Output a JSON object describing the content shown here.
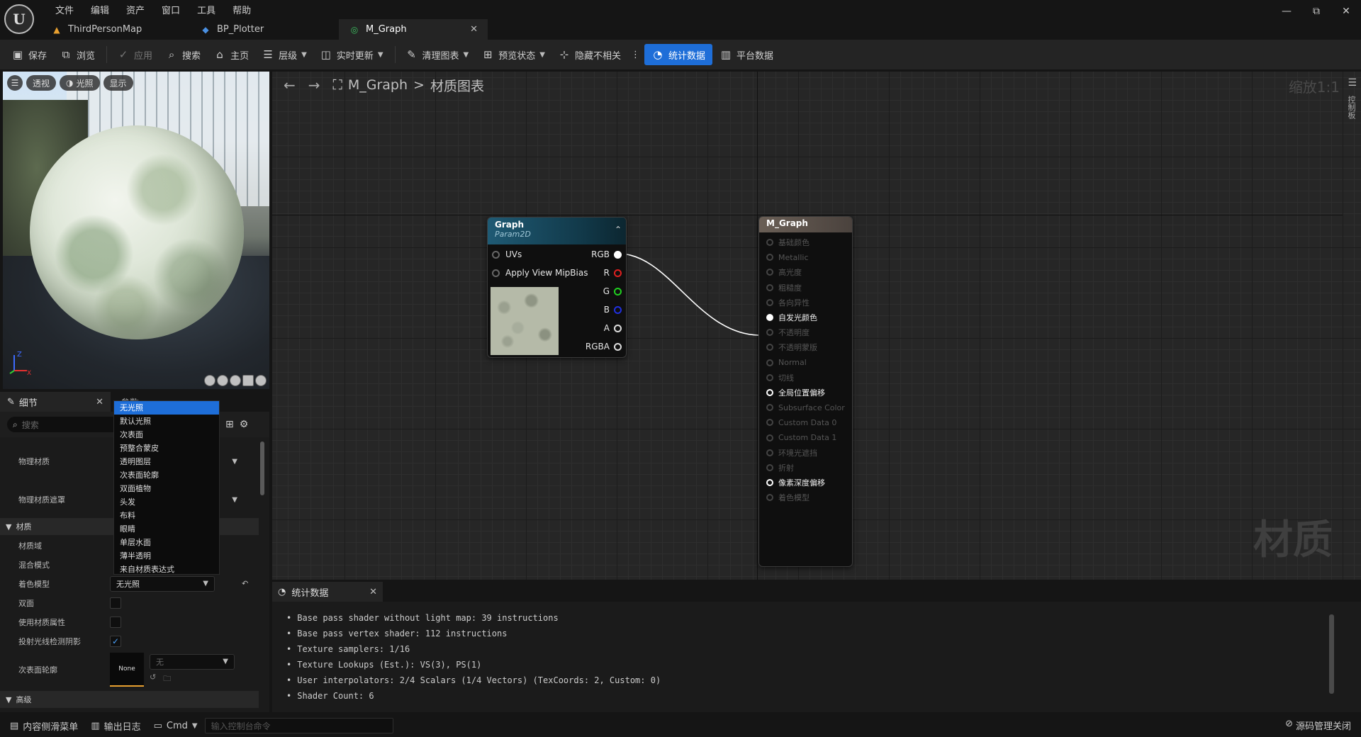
{
  "app": {
    "menu": [
      "文件",
      "编辑",
      "资产",
      "窗口",
      "工具",
      "帮助"
    ],
    "window_controls": [
      "—",
      "⧉",
      "✕"
    ]
  },
  "doc_tabs": [
    {
      "label": "ThirdPersonMap",
      "icon": "map-icon"
    },
    {
      "label": "BP_Plotter",
      "icon": "blueprint-icon"
    },
    {
      "label": "M_Graph",
      "icon": "material-icon",
      "active": true
    }
  ],
  "toolbar": {
    "save": "保存",
    "browse": "浏览",
    "apply": "应用",
    "search": "搜索",
    "home": "主页",
    "hierarchy": "层级",
    "live_update": "实时更新",
    "clean_graph": "清理图表",
    "preview_state": "预览状态",
    "hide_unrelated": "隐藏不相关",
    "stats": "统计数据",
    "platform_stats": "平台数据"
  },
  "viewport": {
    "perspective": "透视",
    "lit": "光照",
    "show": "显示",
    "axis_z": "Z",
    "axis_x": "X"
  },
  "details": {
    "tab_label": "细节",
    "params_tab": "参数",
    "search_placeholder": "搜索",
    "rows": {
      "phys_material": "物理材质",
      "phys_material_mask": "物理材质遮罩",
      "material_cat": "材质",
      "material_domain": "材质域",
      "blend_mode": "混合模式",
      "shading_model": "着色模型",
      "shading_model_value": "无光照",
      "two_sided": "双面",
      "use_material_attributes": "使用材质属性",
      "cast_ray_traced_shadows": "投射光线检测阴影",
      "subsurface_profile": "次表面轮廓",
      "subsurface_none": "None",
      "subsurface_value": "无",
      "advanced_cat": "高级"
    }
  },
  "dropdown_options": [
    "无光照",
    "默认光照",
    "次表面",
    "预整合蒙皮",
    "透明图层",
    "次表面轮廓",
    "双面植物",
    "头发",
    "布料",
    "眼睛",
    "单层水面",
    "薄半透明",
    "来自材质表达式"
  ],
  "graph": {
    "breadcrumb_root": "M_Graph",
    "breadcrumb_sep": ">",
    "breadcrumb_page": "材质图表",
    "zoom": "缩放1:1",
    "watermark": "材质",
    "rail_label": "控制板"
  },
  "node_texture": {
    "title": "Graph",
    "subtitle": "Param2D",
    "inputs": [
      "UVs",
      "Apply View MipBias"
    ],
    "outputs": [
      {
        "label": "RGB",
        "color": "#ffffff"
      },
      {
        "label": "R",
        "color": "#e02020"
      },
      {
        "label": "G",
        "color": "#20d020"
      },
      {
        "label": "B",
        "color": "#2030e0"
      },
      {
        "label": "A",
        "color": "#dddddd"
      },
      {
        "label": "RGBA",
        "color": "#dddddd"
      }
    ]
  },
  "node_material": {
    "title": "M_Graph",
    "pins": [
      {
        "label": "基础颜色",
        "active": false
      },
      {
        "label": "Metallic",
        "active": false
      },
      {
        "label": "高光度",
        "active": false
      },
      {
        "label": "粗糙度",
        "active": false
      },
      {
        "label": "各向异性",
        "active": false
      },
      {
        "label": "自发光颜色",
        "active": true,
        "connected": true
      },
      {
        "label": "不透明度",
        "active": false
      },
      {
        "label": "不透明蒙版",
        "active": false
      },
      {
        "label": "Normal",
        "active": false
      },
      {
        "label": "切线",
        "active": false
      },
      {
        "label": "全局位置偏移",
        "active": true
      },
      {
        "label": "Subsurface Color",
        "active": false
      },
      {
        "label": "Custom Data 0",
        "active": false
      },
      {
        "label": "Custom Data 1",
        "active": false
      },
      {
        "label": "环境光遮挡",
        "active": false
      },
      {
        "label": "折射",
        "active": false
      },
      {
        "label": "像素深度偏移",
        "active": true
      },
      {
        "label": "着色模型",
        "active": false
      }
    ]
  },
  "stats": {
    "tab_label": "统计数据",
    "lines": [
      "Base pass shader without light map: 39 instructions",
      "Base pass vertex shader: 112 instructions",
      "Texture samplers: 1/16",
      "Texture Lookups (Est.): VS(3), PS(1)",
      "User interpolators: 2/4 Scalars (1/4 Vectors) (TexCoords: 2, Custom: 0)",
      "Shader Count: 6"
    ]
  },
  "statusbar": {
    "content_drawer": "内容侧滑菜单",
    "output_log": "输出日志",
    "cmd": "Cmd",
    "console_placeholder": "输入控制台命令",
    "source_control": "源码管理关闭"
  }
}
